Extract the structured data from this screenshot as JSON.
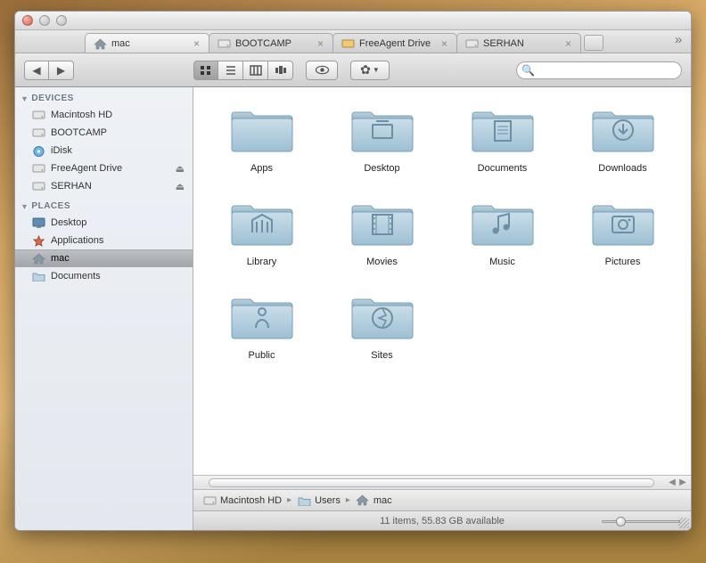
{
  "tabs": [
    {
      "label": "mac",
      "icon": "home",
      "active": true
    },
    {
      "label": "BOOTCAMP",
      "icon": "drive",
      "active": false
    },
    {
      "label": "FreeAgent Drive",
      "icon": "drive-ext",
      "active": false
    },
    {
      "label": "SERHAN",
      "icon": "drive",
      "active": false
    }
  ],
  "search": {
    "placeholder": ""
  },
  "sidebar": {
    "sections": [
      {
        "title": "DEVICES",
        "items": [
          {
            "label": "Macintosh HD",
            "icon": "hd",
            "eject": false
          },
          {
            "label": "BOOTCAMP",
            "icon": "hd",
            "eject": false
          },
          {
            "label": "iDisk",
            "icon": "idisk",
            "eject": false
          },
          {
            "label": "FreeAgent Drive",
            "icon": "hd",
            "eject": true
          },
          {
            "label": "SERHAN",
            "icon": "hd",
            "eject": true
          }
        ]
      },
      {
        "title": "PLACES",
        "items": [
          {
            "label": "Desktop",
            "icon": "desktop",
            "eject": false
          },
          {
            "label": "Applications",
            "icon": "apps",
            "eject": false
          },
          {
            "label": "mac",
            "icon": "home",
            "eject": false,
            "selected": true
          },
          {
            "label": "Documents",
            "icon": "folder",
            "eject": false
          }
        ]
      }
    ]
  },
  "folders": [
    {
      "label": "Apps",
      "icon": "plain"
    },
    {
      "label": "Desktop",
      "icon": "desktop"
    },
    {
      "label": "Documents",
      "icon": "documents"
    },
    {
      "label": "Downloads",
      "icon": "downloads"
    },
    {
      "label": "Library",
      "icon": "library"
    },
    {
      "label": "Movies",
      "icon": "movies"
    },
    {
      "label": "Music",
      "icon": "music"
    },
    {
      "label": "Pictures",
      "icon": "pictures"
    },
    {
      "label": "Public",
      "icon": "public"
    },
    {
      "label": "Sites",
      "icon": "sites"
    }
  ],
  "path": [
    {
      "label": "Macintosh HD",
      "icon": "hd"
    },
    {
      "label": "Users",
      "icon": "folder"
    },
    {
      "label": "mac",
      "icon": "home"
    }
  ],
  "status": "11 items, 55.83 GB available"
}
